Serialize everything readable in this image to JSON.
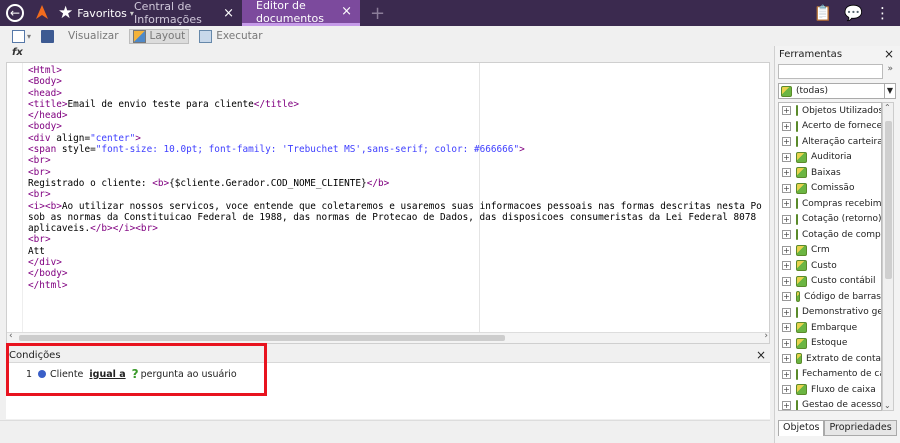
{
  "topbar": {
    "favorites_label": "Favoritos",
    "tabs": [
      {
        "label": "Central de Informações"
      },
      {
        "label": "Editor de documentos"
      }
    ],
    "close_glyph": "×",
    "add_glyph": "+"
  },
  "toolbar": {
    "visualizar": "Visualizar",
    "layout": "Layout",
    "executar": "Executar"
  },
  "fx_label": "fx",
  "editor": {
    "lines": [
      "<Html>",
      "<Body>",
      "<head>",
      "<title>Email de envio teste para cliente</title>",
      "</head>",
      "<body>",
      "<div align=\"center\">",
      "<span style=\"font-size: 10.0pt; font-family: 'Trebuchet MS',sans-serif; color: #666666\">",
      "<br>",
      "<br>",
      "Registrado o cliente: <b>{$cliente.Gerador.COD_NOME_CLIENTE}</b>",
      "<br>",
      "<i><b>Ao utilizar nossos servicos, voce entende que coletaremos e usaremos suas informacoes pessoais nas formas descritas nesta Po",
      "sob as normas da Constituicao Federal de 1988, das normas de Protecao de Dados, das disposicoes consumeristas da Lei Federal 8078",
      "aplicaveis.</b></i><br>",
      "<br>",
      "Att",
      "</div>",
      "</body>",
      "</html>"
    ]
  },
  "conditions": {
    "title": "Condições",
    "row": {
      "number": "1",
      "field": "Cliente",
      "operator": "igual a",
      "value": "pergunta ao usuário"
    }
  },
  "tools": {
    "title": "Ferramentas",
    "filter_selected": "(todas)",
    "items": [
      "Objetos Utilizados",
      "Acerto de fornecedor",
      "Alteração carteira",
      "Auditoria",
      "Baixas",
      "Comissão",
      "Compras recebimento",
      "Cotação (retorno)",
      "Cotação de compra",
      "Crm",
      "Custo",
      "Custo contábil",
      "Código de barras",
      "Demonstrativo gerencial",
      "Embarque",
      "Estoque",
      "Extrato de conta",
      "Fechamento de caixa",
      "Fluxo de caixa",
      "Gestao de acesso"
    ],
    "tabs": [
      "Objetos",
      "Propriedades"
    ]
  }
}
